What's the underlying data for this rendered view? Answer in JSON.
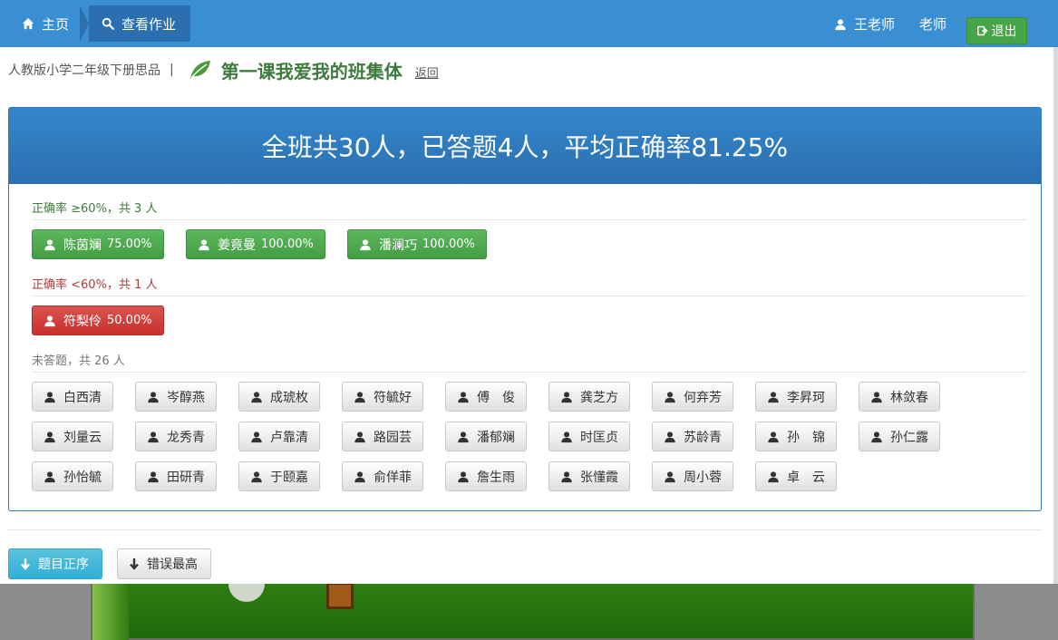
{
  "nav": {
    "home": "主页",
    "current": "查看作业",
    "user": "王老师",
    "role": "老师",
    "logout": "退出"
  },
  "breadcrumb": {
    "course": "人教版小学二年级下册思品",
    "sep": "|",
    "lesson": "第一课我爱我的班集体",
    "back": "返回"
  },
  "summary": {
    "text": "全班共30人，已答题4人，平均正确率81.25%"
  },
  "groups": {
    "good": {
      "label": "正确率 ≥60%，共 3 人",
      "students": [
        {
          "name": "陈茵斓",
          "score": "75.00%"
        },
        {
          "name": "姜竟曼",
          "score": "100.00%"
        },
        {
          "name": "潘澜巧",
          "score": "100.00%"
        }
      ]
    },
    "bad": {
      "label": "正确率 <60%，共 1 人",
      "students": [
        {
          "name": "符梨伶",
          "score": "50.00%"
        }
      ]
    },
    "none": {
      "label": "未答题，共 26 人",
      "students": [
        {
          "name": "白西清"
        },
        {
          "name": "岑醇燕"
        },
        {
          "name": "成琥枚"
        },
        {
          "name": "符毓好"
        },
        {
          "name": "傅　俊"
        },
        {
          "name": "龚芝方"
        },
        {
          "name": "何弃芳"
        },
        {
          "name": "李昇珂"
        },
        {
          "name": "林敛春"
        },
        {
          "name": "刘量云"
        },
        {
          "name": "龙秀青"
        },
        {
          "name": "卢靠清"
        },
        {
          "name": "路园芸"
        },
        {
          "name": "潘郁斓"
        },
        {
          "name": "时匡贞"
        },
        {
          "name": "苏龄青"
        },
        {
          "name": "孙　锦"
        },
        {
          "name": "孙仁露"
        },
        {
          "name": "孙怡毓"
        },
        {
          "name": "田研青"
        },
        {
          "name": "于颐嘉"
        },
        {
          "name": "俞佯菲"
        },
        {
          "name": "詹生雨"
        },
        {
          "name": "张懂霞"
        },
        {
          "name": "周小蓉"
        },
        {
          "name": "卓　云"
        }
      ]
    }
  },
  "sort": {
    "asc": "题目正序",
    "error": "错误最高"
  },
  "colors": {
    "navbar": "#3a8fd3",
    "panel_head": "#2b6fb0",
    "good": "#5cb85c",
    "bad": "#d9534f",
    "info": "#5bc0de"
  }
}
